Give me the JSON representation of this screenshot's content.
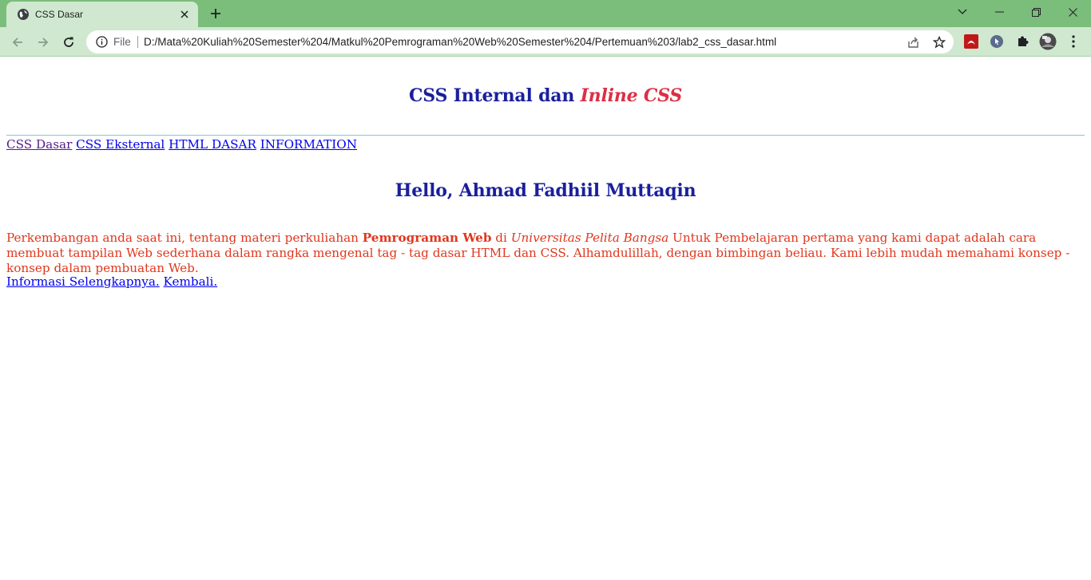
{
  "browser": {
    "tab": {
      "title": "CSS Dasar",
      "favicon": "globe-icon",
      "close_icon": "close-icon"
    },
    "new_tab_icon": "plus-icon",
    "window_controls": [
      "chevron-down-icon",
      "minimize-icon",
      "restore-icon",
      "close-icon"
    ],
    "nav_buttons": [
      "back-icon",
      "forward-icon",
      "reload-icon"
    ],
    "address_bar": {
      "scheme_label": "File",
      "url": "D:/Mata%20Kuliah%20Semester%204/Matkul%20Pemrograman%20Web%20Semester%204/Pertemuan%203/lab2_css_dasar.html",
      "actions": [
        "share-icon",
        "star-icon"
      ]
    },
    "extensions": [
      "pdf-extension-icon",
      "cursor-extension-icon",
      "puzzle-icon",
      "profile-avatar-icon",
      "kebab-menu-icon"
    ],
    "colors": {
      "tabstrip": "#7bbd7b",
      "toolbar": "#cfe8cf"
    }
  },
  "page": {
    "heading": {
      "text_regular": "CSS Internal dan ",
      "text_italic": "Inline CSS"
    },
    "nav_links": [
      "CSS Dasar",
      "CSS Eksternal",
      "HTML DASAR",
      "INFORMATION"
    ],
    "greeting": "Hello, Ahmad Fadhiil Muttaqin",
    "paragraph": {
      "part1": "Perkembangan anda saat ini, tentang materi perkuliahan ",
      "bold": "Pemrograman Web",
      "part2": " di ",
      "italic": "Universitas Pelita Bangsa",
      "part3": " Untuk Pembelajaran pertama yang kami dapat adalah cara membuat tampilan Web sederhana dalam rangka mengenal tag - tag dasar HTML dan CSS. Alhamdulillah, dengan bimbingan beliau. Kami lebih mudah memahami konsep - konsep dalam pembuatan Web."
    },
    "footer_links": [
      "Informasi Selengkapnya.",
      "Kembali."
    ],
    "colors": {
      "heading": "#1a1f9c",
      "italic_heading": "#dc2f45",
      "paragraph": "#e0371d",
      "rule": "#7fc9d9"
    }
  }
}
